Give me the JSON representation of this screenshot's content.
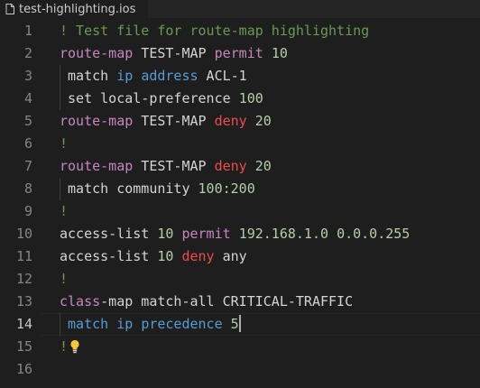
{
  "tab": {
    "title": "test-highlighting.ios",
    "icon": "file-icon"
  },
  "colors": {
    "background": "#1e1e1e",
    "comment": "#6a9955",
    "keyword": "#c586c0",
    "deny": "#f14c4c",
    "number": "#b5cea8",
    "ip": "#569cd6",
    "text": "#d4d4d4"
  },
  "editor": {
    "current_line": 14,
    "lines": [
      {
        "n": "1",
        "tokens": [
          [
            "comment",
            "! Test file for route-map highlighting"
          ]
        ]
      },
      {
        "n": "2",
        "tokens": [
          [
            "keyword",
            "route-map"
          ],
          [
            "plain",
            " TEST-MAP "
          ],
          [
            "permit",
            "permit"
          ],
          [
            "plain",
            " "
          ],
          [
            "number",
            "10"
          ]
        ]
      },
      {
        "n": "3",
        "indent": true,
        "tokens": [
          [
            "plain",
            " match "
          ],
          [
            "ip",
            "ip"
          ],
          [
            "plain",
            " "
          ],
          [
            "ip",
            "address"
          ],
          [
            "plain",
            " ACL-1"
          ]
        ]
      },
      {
        "n": "4",
        "indent": true,
        "tokens": [
          [
            "plain",
            " set local-preference "
          ],
          [
            "number",
            "100"
          ]
        ]
      },
      {
        "n": "5",
        "tokens": [
          [
            "keyword",
            "route-map"
          ],
          [
            "plain",
            " TEST-MAP "
          ],
          [
            "deny",
            "deny"
          ],
          [
            "plain",
            " "
          ],
          [
            "number",
            "20"
          ]
        ]
      },
      {
        "n": "6",
        "tokens": [
          [
            "comment",
            "!"
          ]
        ]
      },
      {
        "n": "7",
        "tokens": [
          [
            "keyword",
            "route-map"
          ],
          [
            "plain",
            " TEST-MAP "
          ],
          [
            "deny",
            "deny"
          ],
          [
            "plain",
            " "
          ],
          [
            "number",
            "20"
          ]
        ]
      },
      {
        "n": "8",
        "indent": true,
        "tokens": [
          [
            "plain",
            " match community "
          ],
          [
            "number",
            "100:200"
          ]
        ]
      },
      {
        "n": "9",
        "tokens": [
          [
            "comment",
            "!"
          ]
        ]
      },
      {
        "n": "10",
        "tokens": [
          [
            "plain",
            "access-list "
          ],
          [
            "number",
            "10"
          ],
          [
            "plain",
            " "
          ],
          [
            "permit",
            "permit"
          ],
          [
            "plain",
            " "
          ],
          [
            "number",
            "192.168.1.0"
          ],
          [
            "plain",
            " "
          ],
          [
            "number",
            "0.0.0.255"
          ]
        ]
      },
      {
        "n": "11",
        "tokens": [
          [
            "plain",
            "access-list "
          ],
          [
            "number",
            "10"
          ],
          [
            "plain",
            " "
          ],
          [
            "deny",
            "deny"
          ],
          [
            "plain",
            " any"
          ]
        ]
      },
      {
        "n": "12",
        "tokens": [
          [
            "comment",
            "!"
          ]
        ]
      },
      {
        "n": "13",
        "tokens": [
          [
            "keyword",
            "class"
          ],
          [
            "plain",
            "-map match-all CRITICAL-TRAFFIC"
          ]
        ]
      },
      {
        "n": "14",
        "indent": true,
        "cursor": true,
        "tokens": [
          [
            "plain",
            " "
          ],
          [
            "ip",
            "match"
          ],
          [
            "plain",
            " "
          ],
          [
            "ip",
            "ip"
          ],
          [
            "plain",
            " "
          ],
          [
            "ip",
            "precedence"
          ],
          [
            "plain",
            " "
          ],
          [
            "number",
            "5"
          ]
        ]
      },
      {
        "n": "15",
        "bulb": true,
        "tokens": [
          [
            "comment",
            "!"
          ]
        ]
      },
      {
        "n": "16",
        "tokens": []
      }
    ]
  }
}
